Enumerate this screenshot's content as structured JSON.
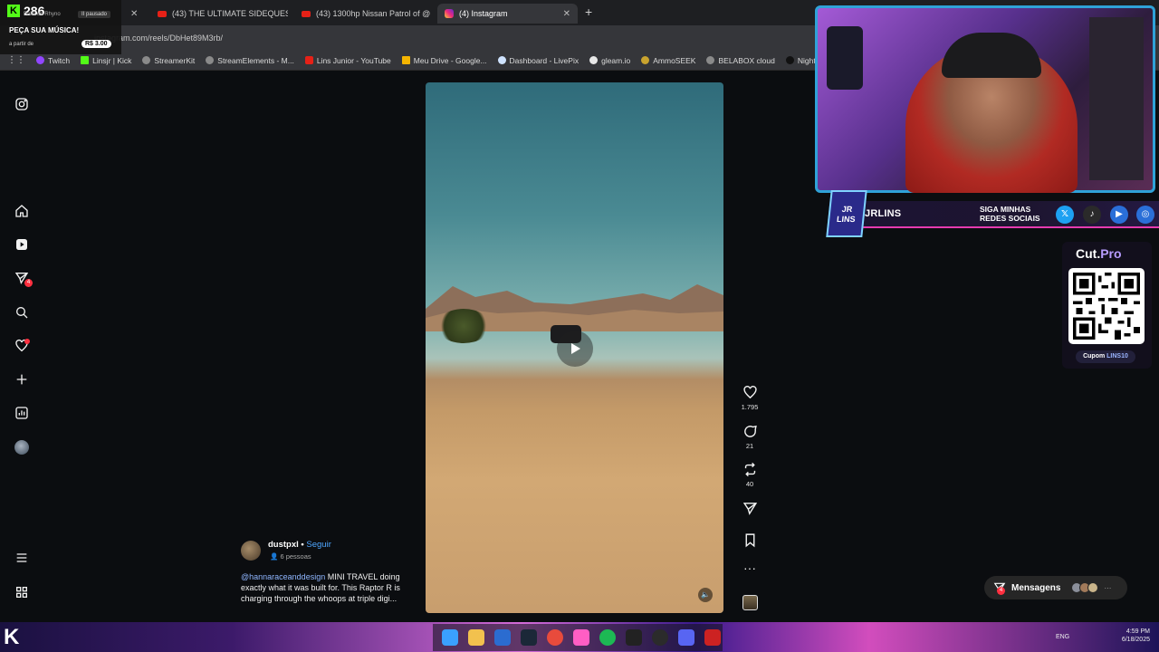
{
  "browser": {
    "tabs": [
      {
        "label": "(43) THE ULTIMATE SIDEQUEST",
        "icon": "youtube-icon"
      },
      {
        "label": "(43) 1300hp Nissan Patrol of @",
        "icon": "youtube-icon"
      },
      {
        "label": "(4) Instagram",
        "icon": "instagram-icon",
        "active": true
      }
    ],
    "url": "instagram.com/reels/DbHet89M3rb/",
    "bookmarks": [
      "Twitch",
      "Linsjr | Kick",
      "StreamerKit",
      "StreamElements - M...",
      "Lins Junior - YouTube",
      "Meu Drive - Google...",
      "Dashboard - LivePix",
      "gleam.io",
      "AmmoSEEK",
      "BELABOX cloud",
      "Nightbot - Comm"
    ]
  },
  "kick_overlay": {
    "count": "286",
    "subtitle": "Balla do Rhyno",
    "status": "II pausado",
    "title": "PEÇA SUA MÚSICA!",
    "from_label": "a partir de",
    "price": "R$ 3.00"
  },
  "nav": {
    "notifications_badge": "4"
  },
  "reel": {
    "likes": "1.795",
    "comments": "21",
    "reposts": "40",
    "author": "dustpxl",
    "separator": "•",
    "follow_label": "Seguir",
    "people": "6 pessoas",
    "mention": "@hannaraceanddesign",
    "caption": " MINI TRAVEL doing exactly what it was built for. This Raptor R is charging through the whoops at triple digi..."
  },
  "stream_overlay": {
    "name": "JRLINS",
    "logo": "JR LINS",
    "siga": "SIGA MINHAS REDES SOCIAIS",
    "social": [
      {
        "icon": "x-icon",
        "glyph": "𝕏",
        "color": "#1da1f2"
      },
      {
        "icon": "tiktok-icon",
        "glyph": "♪",
        "color": "#2a2a2a"
      },
      {
        "icon": "youtube-icon",
        "glyph": "▶",
        "color": "#2a6fd8"
      },
      {
        "icon": "instagram-icon",
        "glyph": "◎",
        "color": "#2a6fd8"
      }
    ],
    "cutpro_brand": "Cut.",
    "cutpro_brand2": "Pro",
    "cupom_label": "Cupom",
    "cupom_code": "LINS10"
  },
  "messages": {
    "label": "Mensagens",
    "badge": "4"
  },
  "taskbar": {
    "lang": "ENG",
    "time": "4:59 PM",
    "date": "6/18/2025"
  }
}
